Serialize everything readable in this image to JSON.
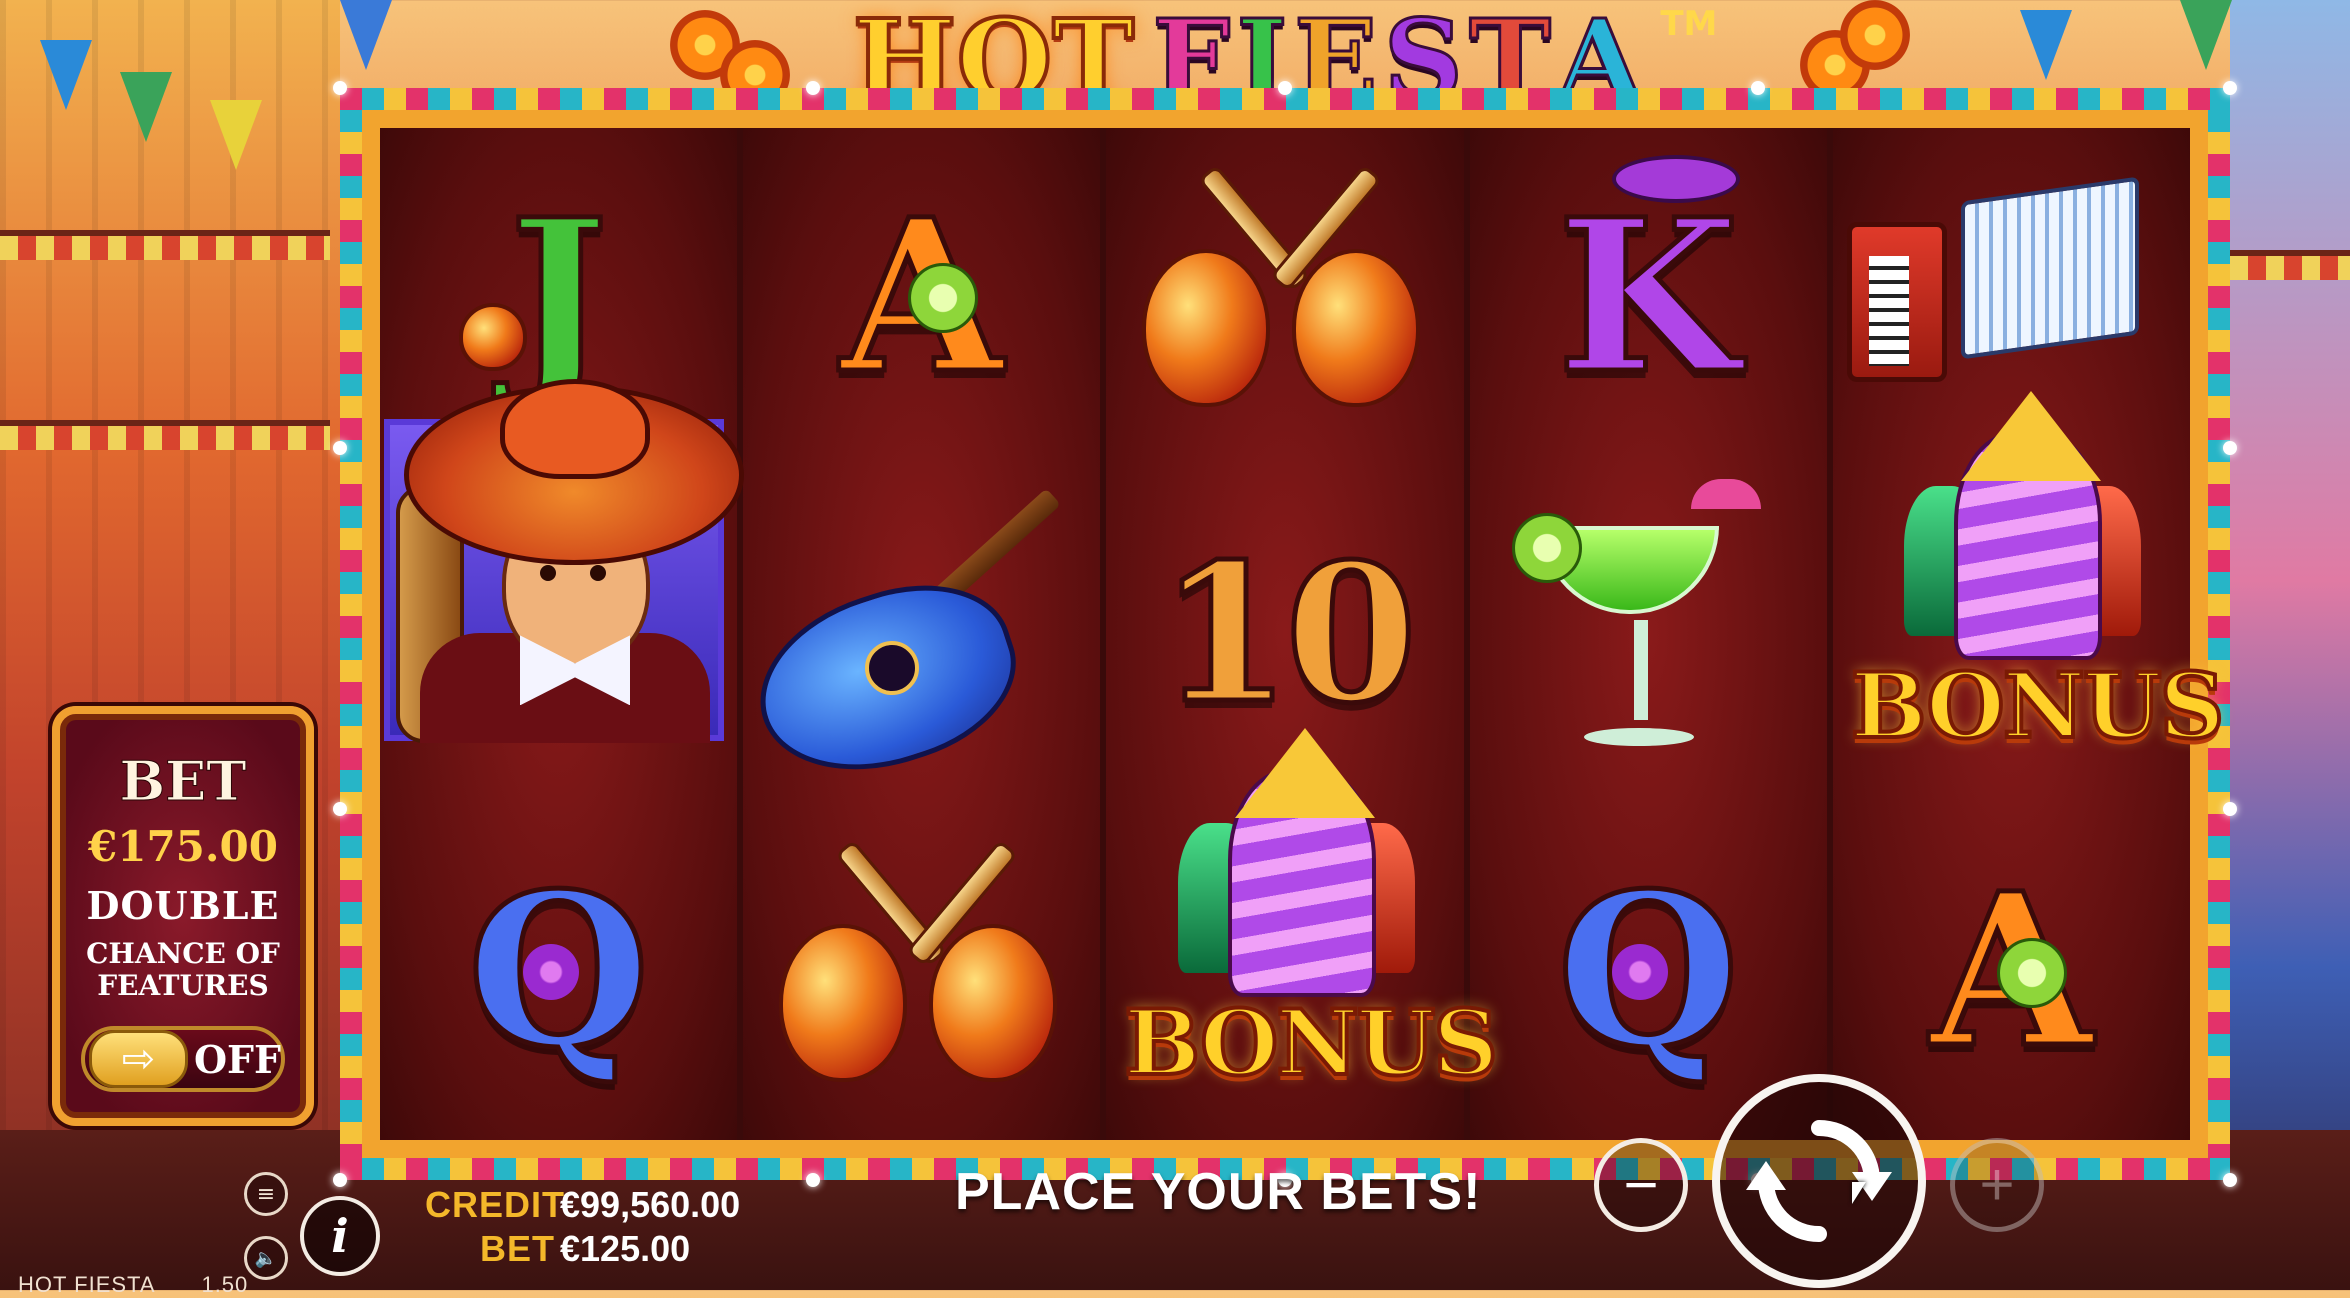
{
  "title": {
    "hot": "HOT",
    "fiesta_letters": [
      "F",
      "I",
      "E",
      "S",
      "T",
      "A"
    ],
    "fiesta_colors": [
      "#e33a9a",
      "#37c24a",
      "#f0a32a",
      "#a23ae0",
      "#e24a3a",
      "#2ab4d8"
    ],
    "trademark": "TM"
  },
  "reels": [
    [
      {
        "symbol": "J",
        "icon": "maraca-j"
      },
      {
        "symbol": "mariachi",
        "icon": "mariachi-wild-icon"
      },
      {
        "symbol": "Q",
        "icon": "rose-q"
      }
    ],
    [
      {
        "symbol": "A",
        "icon": "lime-a"
      },
      {
        "symbol": "guitar",
        "icon": "guitar-icon"
      },
      {
        "symbol": "maracas",
        "icon": "maracas-icon"
      }
    ],
    [
      {
        "symbol": "maracas",
        "icon": "maracas-icon"
      },
      {
        "symbol": "10",
        "icon": "ten"
      },
      {
        "symbol": "bonus",
        "icon": "bonus-fireworks-icon"
      }
    ],
    [
      {
        "symbol": "K",
        "icon": "sombrero-k"
      },
      {
        "symbol": "margarita",
        "icon": "margarita-icon"
      },
      {
        "symbol": "Q",
        "icon": "rose-q"
      }
    ],
    [
      {
        "symbol": "accordion",
        "icon": "accordion-icon"
      },
      {
        "symbol": "bonus",
        "icon": "bonus-fireworks-icon"
      },
      {
        "symbol": "A",
        "icon": "lime-a"
      }
    ]
  ],
  "bonus_label": "BONUS",
  "bet_panel": {
    "title": "BET",
    "amount": "€175.00",
    "line1": "DOUBLE",
    "line2": "CHANCE OF",
    "line3": "FEATURES",
    "toggle_arrow": "⇨",
    "toggle_state": "OFF"
  },
  "status": {
    "credit_label": "CREDIT",
    "credit_value": "€99,560.00",
    "bet_label": "BET",
    "bet_value": "€125.00",
    "message": "PLACE YOUR BETS!"
  },
  "controls": {
    "menu_icon": "≡",
    "sound_icon": "🔈",
    "info_icon": "i",
    "minus": "−",
    "plus": "+"
  },
  "footer": {
    "game_name": "HOT FIESTA",
    "version": "1.50"
  },
  "colors": {
    "frame": "#f2a42e",
    "reel_bg": "#6a1010",
    "accent_gold": "#f4b82a"
  }
}
